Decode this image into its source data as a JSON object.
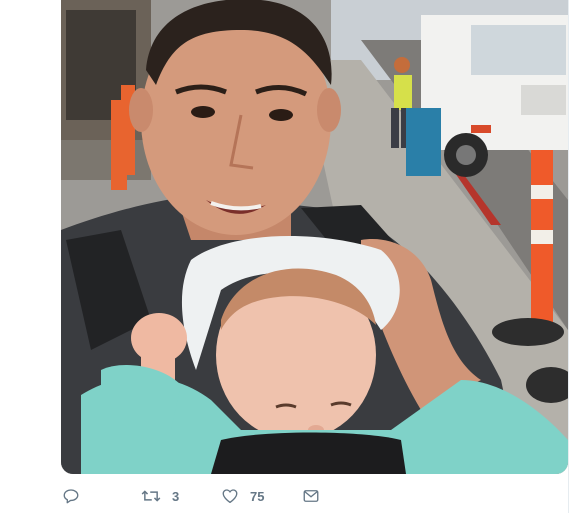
{
  "tweet": {
    "media": {
      "description_icon": "photo"
    },
    "actions": {
      "reply": {
        "icon": "reply-icon",
        "count": ""
      },
      "retweet": {
        "icon": "retweet-icon",
        "count": "3"
      },
      "like": {
        "icon": "heart-icon",
        "count": "75"
      },
      "dm": {
        "icon": "envelope-icon",
        "count": ""
      }
    }
  },
  "colors": {
    "icon_gray": "#657786",
    "border": "#e6ecf0"
  }
}
